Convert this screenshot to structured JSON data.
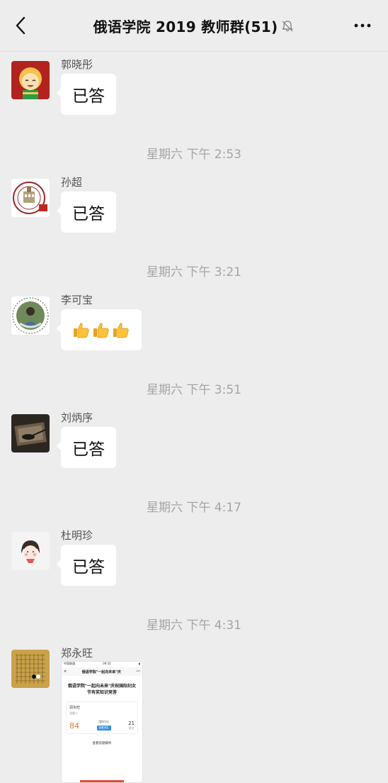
{
  "header": {
    "title": "俄语学院 2019 教师群(51)"
  },
  "messages": [
    {
      "name": "郭晓彤",
      "text": "已答"
    },
    {
      "name": "孙超",
      "text": "已答"
    },
    {
      "name": "李可宝",
      "emoji": "👍👍👍"
    },
    {
      "name": "刘炳序",
      "text": "已答"
    },
    {
      "name": "杜明珍",
      "text": "已答"
    },
    {
      "name": "郑永旺"
    }
  ],
  "timestamps": [
    "星期六 下午 2:53",
    "星期六 下午 3:21",
    "星期六 下午 3:51",
    "星期六 下午 4:17",
    "星期六 下午 4:31"
  ],
  "image_card": {
    "status_left": "中国联通",
    "status_time": "09:35",
    "nav_title": "俄语学院\"一起向未来\"庆",
    "title": "俄语学院\"一起向未来\"庆祝国际妇女节有奖知识竞答",
    "user": "郑永旺",
    "user_sub": "答题人",
    "score": "84",
    "mid_label": "用时1分",
    "tag": "查看排名",
    "count": "21",
    "count_label": "排名",
    "button": "查看答题解析"
  }
}
